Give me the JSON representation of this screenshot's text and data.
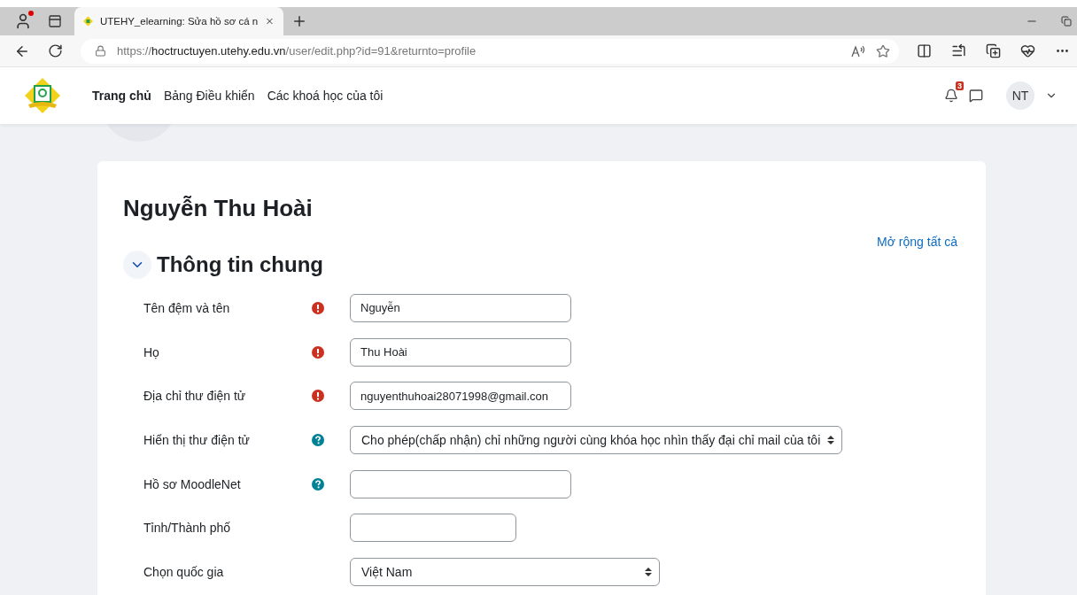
{
  "browser": {
    "tab_title": "UTEHY_elearning: Sửa hồ sơ cá n",
    "url_host": "hoctructuyen.utehy.edu.vn",
    "url_prefix": "https://",
    "url_path": "/user/edit.php?id=91&returnto=profile"
  },
  "nav": {
    "items": [
      {
        "label": "Trang chủ",
        "selected": true
      },
      {
        "label": "Bảng Điều khiển",
        "selected": false
      },
      {
        "label": "Các khoá học của tôi",
        "selected": false
      }
    ],
    "notification_count": "3",
    "user_initials": "NT"
  },
  "page": {
    "title": "Nguyễn Thu Hoài",
    "expand_all": "Mở rộng tất cả",
    "section": {
      "title": "Thông tin chung",
      "expanded": true
    },
    "fields": [
      {
        "label": "Tên đệm và tên",
        "required": true,
        "help": false,
        "kind": "text",
        "value": "Nguyễn"
      },
      {
        "label": "Họ",
        "required": true,
        "help": false,
        "kind": "text",
        "value": "Thu Hoài"
      },
      {
        "label": "Địa chỉ thư điện tử",
        "required": true,
        "help": false,
        "kind": "text",
        "value": "nguyenthuhoai28071998@gmail.con"
      },
      {
        "label": "Hiển thị thư điện tử",
        "required": false,
        "help": true,
        "kind": "select",
        "value": "Cho phép(chấp nhận) chỉ những người cùng khóa học nhìn thấy đại chỉ mail của tôi"
      },
      {
        "label": "Hồ sơ MoodleNet",
        "required": false,
        "help": true,
        "kind": "text"
      },
      {
        "label": "Tỉnh/Thành phố",
        "required": false,
        "help": false,
        "kind": "text"
      },
      {
        "label": "Chọn quốc gia",
        "required": false,
        "help": false,
        "kind": "select",
        "value": "Việt Nam"
      }
    ]
  }
}
